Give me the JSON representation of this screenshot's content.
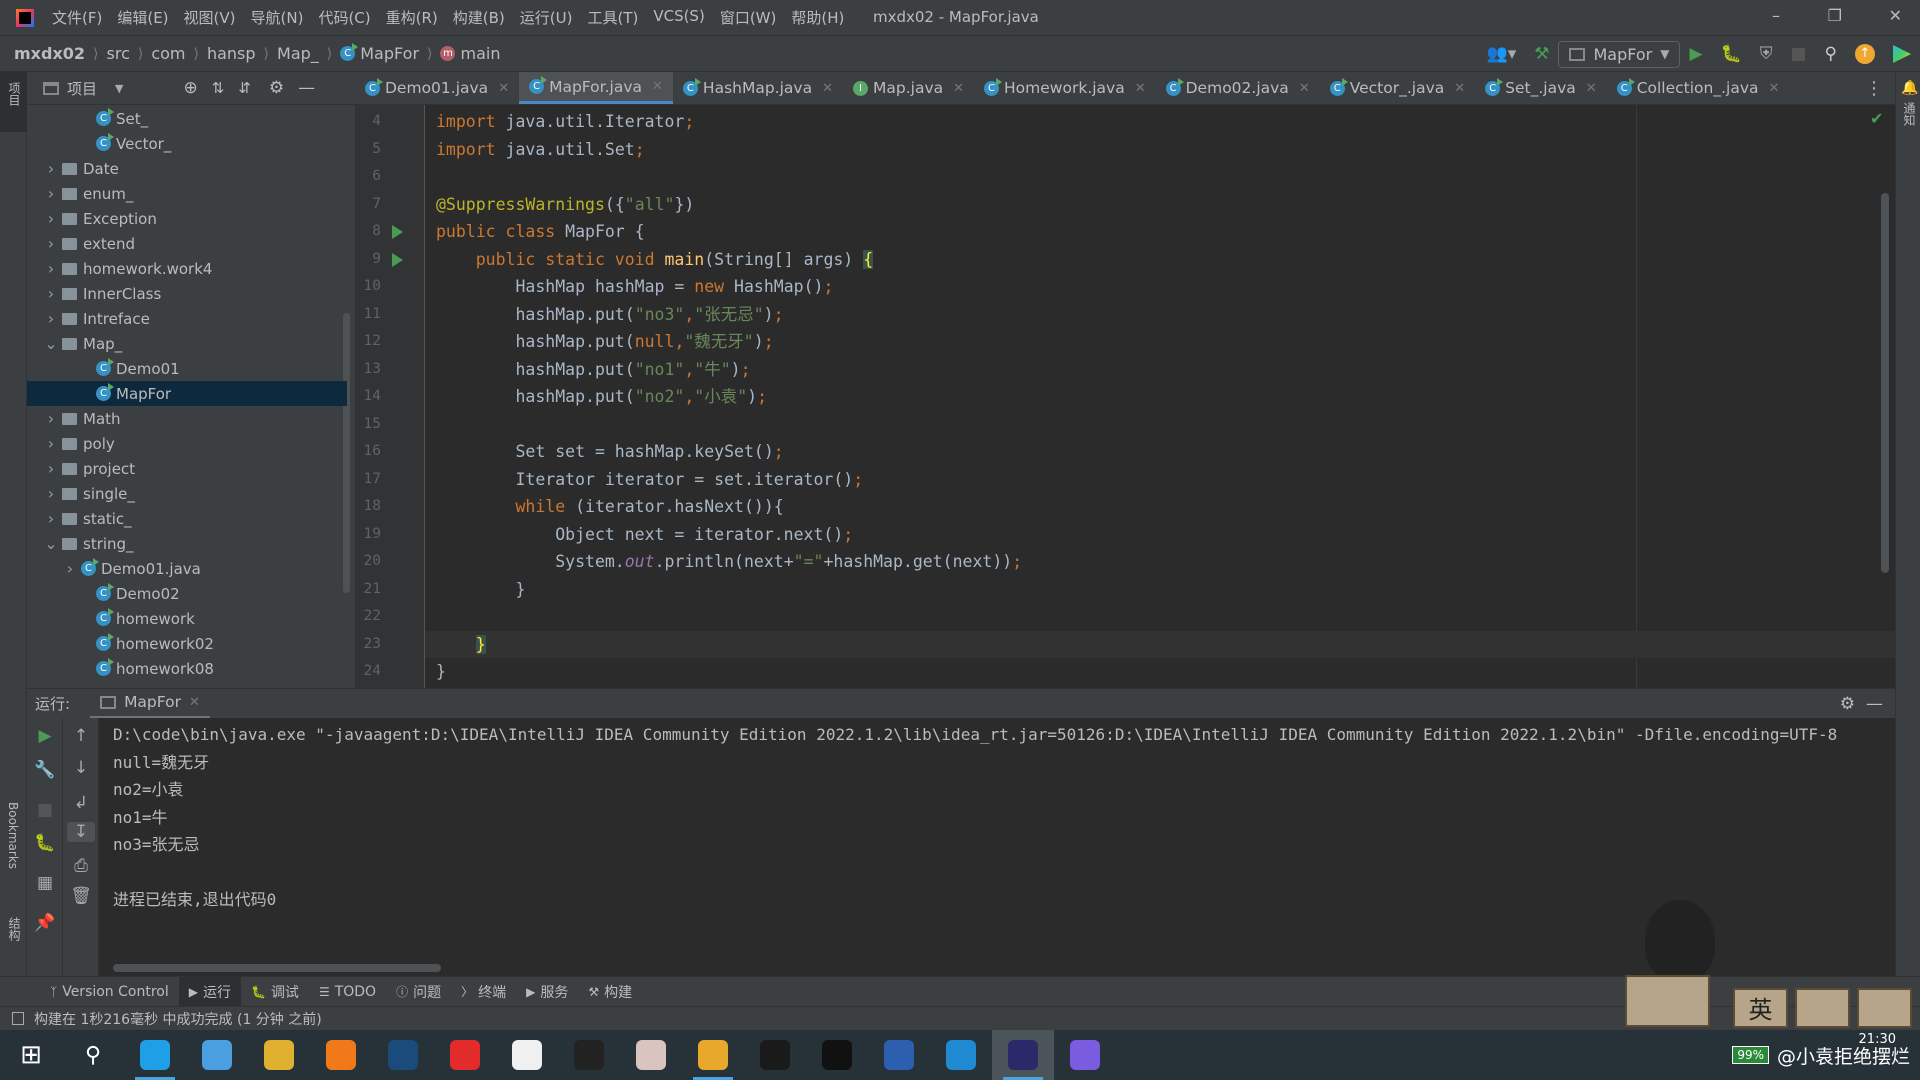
{
  "window": {
    "title": "mxdx02 - MapFor.java"
  },
  "menu": [
    "文件(F)",
    "编辑(E)",
    "视图(V)",
    "导航(N)",
    "代码(C)",
    "重构(R)",
    "构建(B)",
    "运行(U)",
    "工具(T)",
    "VCS(S)",
    "窗口(W)",
    "帮助(H)"
  ],
  "breadcrumb": {
    "project": "mxdx02",
    "items": [
      "src",
      "com",
      "hansp",
      "Map_"
    ],
    "class": "MapFor",
    "method": "main"
  },
  "toolbar": {
    "run_config": "MapFor"
  },
  "left_strip": {
    "project_label": "项目",
    "bookmarks_label": "Bookmarks",
    "structure_label": "结构"
  },
  "right_strip": {
    "notifications_label": "通知"
  },
  "project_panel": {
    "title": "项目",
    "items": [
      {
        "label": "Set_",
        "depth": 2,
        "type": "class"
      },
      {
        "label": "Vector_",
        "depth": 2,
        "type": "class"
      },
      {
        "label": "Date",
        "depth": 1,
        "type": "folder",
        "expanded": false
      },
      {
        "label": "enum_",
        "depth": 1,
        "type": "folder",
        "expanded": false
      },
      {
        "label": "Exception",
        "depth": 1,
        "type": "folder",
        "expanded": false
      },
      {
        "label": "extend",
        "depth": 1,
        "type": "folder",
        "expanded": false
      },
      {
        "label": "homework.work4",
        "depth": 1,
        "type": "folder",
        "expanded": false
      },
      {
        "label": "InnerClass",
        "depth": 1,
        "type": "folder",
        "expanded": false
      },
      {
        "label": "Intreface",
        "depth": 1,
        "type": "folder",
        "expanded": false
      },
      {
        "label": "Map_",
        "depth": 1,
        "type": "folder",
        "expanded": true
      },
      {
        "label": "Demo01",
        "depth": 2,
        "type": "class"
      },
      {
        "label": "MapFor",
        "depth": 2,
        "type": "class",
        "selected": true
      },
      {
        "label": "Math",
        "depth": 1,
        "type": "folder",
        "expanded": false
      },
      {
        "label": "poly",
        "depth": 1,
        "type": "folder",
        "expanded": false
      },
      {
        "label": "project",
        "depth": 1,
        "type": "folder",
        "expanded": false
      },
      {
        "label": "single_",
        "depth": 1,
        "type": "folder",
        "expanded": false
      },
      {
        "label": "static_",
        "depth": 1,
        "type": "folder",
        "expanded": false
      },
      {
        "label": "string_",
        "depth": 1,
        "type": "folder",
        "expanded": true
      },
      {
        "label": "Demo01.java",
        "depth": 2,
        "type": "file-collapsed"
      },
      {
        "label": "Demo02",
        "depth": 2,
        "type": "class"
      },
      {
        "label": "homework",
        "depth": 2,
        "type": "class"
      },
      {
        "label": "homework02",
        "depth": 2,
        "type": "class"
      },
      {
        "label": "homework08",
        "depth": 2,
        "type": "class"
      }
    ]
  },
  "tabs": [
    {
      "label": "Demo01.java",
      "icon": "class"
    },
    {
      "label": "MapFor.java",
      "icon": "class",
      "active": true
    },
    {
      "label": "HashMap.java",
      "icon": "class"
    },
    {
      "label": "Map.java",
      "icon": "interface"
    },
    {
      "label": "Homework.java",
      "icon": "class"
    },
    {
      "label": "Demo02.java",
      "icon": "class"
    },
    {
      "label": "Vector_.java",
      "icon": "class"
    },
    {
      "label": "Set_.java",
      "icon": "class"
    },
    {
      "label": "Collection_.java",
      "icon": "class"
    }
  ],
  "editor": {
    "current_line": 23,
    "run_marks": [
      8,
      9
    ],
    "lines": [
      {
        "n": "4",
        "t": [
          [
            "import",
            "k"
          ],
          [
            " java.util.Iterator",
            ""
          ],
          [
            ";",
            "p"
          ]
        ]
      },
      {
        "n": "5",
        "t": [
          [
            "import",
            "k"
          ],
          [
            " java.util.Set",
            ""
          ],
          [
            ";",
            "p"
          ]
        ]
      },
      {
        "n": "6",
        "t": []
      },
      {
        "n": "7",
        "t": [
          [
            "@SuppressWarnings",
            "a"
          ],
          [
            "({",
            ""
          ],
          [
            "\"all\"",
            "s"
          ],
          [
            "})",
            ""
          ]
        ]
      },
      {
        "n": "8",
        "t": [
          [
            "public class ",
            "k"
          ],
          [
            "MapFor {",
            ""
          ]
        ]
      },
      {
        "n": "9",
        "t": [
          [
            "    public static void ",
            "k"
          ],
          [
            "main",
            "f"
          ],
          [
            "(String[] args) ",
            ""
          ],
          [
            "{",
            "brace-hl"
          ]
        ]
      },
      {
        "n": "10",
        "t": [
          [
            "        HashMap hashMap = ",
            ""
          ],
          [
            "new ",
            "k"
          ],
          [
            "HashMap()",
            ""
          ],
          [
            ";",
            "p"
          ]
        ]
      },
      {
        "n": "11",
        "t": [
          [
            "        hashMap.put(",
            ""
          ],
          [
            "\"no3\"",
            "s"
          ],
          [
            ",",
            "p"
          ],
          [
            "\"张无忌\"",
            "s"
          ],
          [
            ")",
            ""
          ],
          [
            ";",
            "p"
          ]
        ]
      },
      {
        "n": "12",
        "t": [
          [
            "        hashMap.put(",
            ""
          ],
          [
            "null",
            "k"
          ],
          [
            ",",
            "p"
          ],
          [
            "\"魏无牙\"",
            "s"
          ],
          [
            ")",
            ""
          ],
          [
            ";",
            "p"
          ]
        ]
      },
      {
        "n": "13",
        "t": [
          [
            "        hashMap.put(",
            ""
          ],
          [
            "\"no1\"",
            "s"
          ],
          [
            ",",
            "p"
          ],
          [
            "\"牛\"",
            "s"
          ],
          [
            ")",
            ""
          ],
          [
            ";",
            "p"
          ]
        ]
      },
      {
        "n": "14",
        "t": [
          [
            "        hashMap.put(",
            ""
          ],
          [
            "\"no2\"",
            "s"
          ],
          [
            ",",
            "p"
          ],
          [
            "\"小袁\"",
            "s"
          ],
          [
            ")",
            ""
          ],
          [
            ";",
            "p"
          ]
        ]
      },
      {
        "n": "15",
        "t": []
      },
      {
        "n": "16",
        "t": [
          [
            "        Set set = hashMap.keySet()",
            ""
          ],
          [
            ";",
            "p"
          ]
        ]
      },
      {
        "n": "17",
        "t": [
          [
            "        Iterator iterator = set.iterator()",
            ""
          ],
          [
            ";",
            "p"
          ]
        ]
      },
      {
        "n": "18",
        "t": [
          [
            "        while ",
            "k"
          ],
          [
            "(iterator.hasNext()){",
            ""
          ]
        ]
      },
      {
        "n": "19",
        "t": [
          [
            "            Object next = iterator.next()",
            ""
          ],
          [
            ";",
            "p"
          ]
        ]
      },
      {
        "n": "20",
        "t": [
          [
            "            System.",
            ""
          ],
          [
            "out",
            "i"
          ],
          [
            ".println(next+",
            ""
          ],
          [
            "\"=\"",
            "s"
          ],
          [
            "+hashMap.get(next))",
            ""
          ],
          [
            ";",
            "p"
          ]
        ]
      },
      {
        "n": "21",
        "t": [
          [
            "        }",
            ""
          ]
        ]
      },
      {
        "n": "22",
        "t": []
      },
      {
        "n": "23",
        "t": [
          [
            "    ",
            ""
          ],
          [
            "}",
            "brace-hl"
          ]
        ]
      },
      {
        "n": "24",
        "t": [
          [
            "}",
            ""
          ]
        ]
      }
    ]
  },
  "run_panel": {
    "label": "运行:",
    "tab": "MapFor",
    "output": [
      "D:\\code\\bin\\java.exe \"-javaagent:D:\\IDEA\\IntelliJ IDEA Community Edition 2022.1.2\\lib\\idea_rt.jar=50126:D:\\IDEA\\IntelliJ IDEA Community Edition 2022.1.2\\bin\" -Dfile.encoding=UTF-8",
      "null=魏无牙",
      "no2=小袁",
      "no1=牛",
      "no3=张无忌",
      "",
      "进程已结束,退出代码0"
    ]
  },
  "bottom_tabs": [
    {
      "label": "Version Control",
      "icon": "branch-icon"
    },
    {
      "label": "运行",
      "icon": "run-icon",
      "active": true
    },
    {
      "label": "调试",
      "icon": "bug-icon"
    },
    {
      "label": "TODO",
      "icon": "list-icon"
    },
    {
      "label": "问题",
      "icon": "info-icon"
    },
    {
      "label": "终端",
      "icon": "terminal-icon"
    },
    {
      "label": "服务",
      "icon": "services-icon"
    },
    {
      "label": "构建",
      "icon": "hammer-icon"
    }
  ],
  "status": {
    "message": "构建在 1秒216毫秒 中成功完成 (1 分钟 之前)"
  },
  "taskbar": {
    "apps": [
      {
        "name": "windows-start",
        "color": "#ffffff"
      },
      {
        "name": "search",
        "color": "#263238"
      },
      {
        "name": "edge",
        "color": "#1fa0e6",
        "running": true
      },
      {
        "name": "file-manager",
        "color": "#4a9fe0"
      },
      {
        "name": "bilibili-mascot",
        "color": "#e0b030"
      },
      {
        "name": "search-app",
        "color": "#f07a1a"
      },
      {
        "name": "steam",
        "color": "#1b4b7a"
      },
      {
        "name": "netease-music",
        "color": "#e22b2b"
      },
      {
        "name": "flash-app",
        "color": "#f0f0f0"
      },
      {
        "name": "epic-games",
        "color": "#222222"
      },
      {
        "name": "anime-app",
        "color": "#d9c4c0"
      },
      {
        "name": "chrome",
        "color": "#e8a82c",
        "running": true
      },
      {
        "name": "g-app",
        "color": "#1a1a1a"
      },
      {
        "name": "qq",
        "color": "#111111"
      },
      {
        "name": "dev-cpp",
        "color": "#2d5fb0"
      },
      {
        "name": "vscode",
        "color": "#1f8ad2"
      },
      {
        "name": "intellij-idea",
        "color": "#2a2a6a",
        "active": true
      },
      {
        "name": "colorful-app",
        "color": "#7a5ce0"
      }
    ],
    "clock": "21:30",
    "battery": "99%",
    "tray_text": "@小袁拒绝摆烂"
  },
  "colors": {
    "accent": "#4a88c7",
    "selection": "#0d293e",
    "run_green": "#499c54"
  }
}
